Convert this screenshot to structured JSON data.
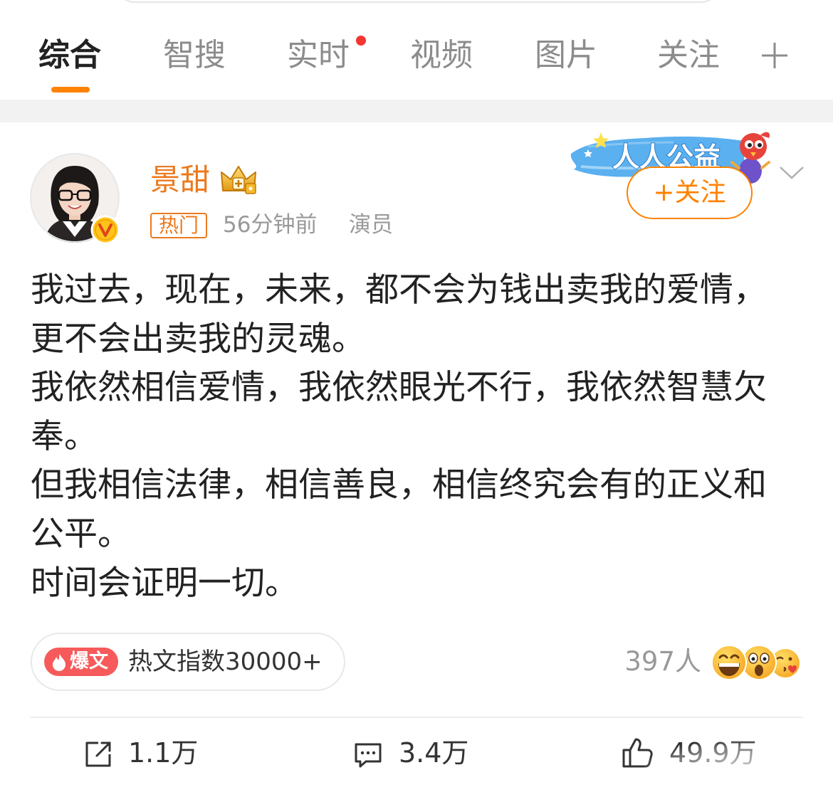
{
  "colors": {
    "accent": "#ff8200",
    "username": "#eb7a1e",
    "hot": "#f65a5a",
    "dot": "#f43530",
    "text": "#222222",
    "muted": "#999999"
  },
  "tabs": {
    "items": [
      {
        "label": "综合",
        "active": true
      },
      {
        "label": "智搜",
        "active": false
      },
      {
        "label": "实时",
        "active": false,
        "dot": true
      },
      {
        "label": "视频",
        "active": false
      },
      {
        "label": "图片",
        "active": false
      },
      {
        "label": "关注",
        "active": false
      }
    ],
    "add_icon": "plus-icon"
  },
  "post": {
    "author": {
      "name": "景甜",
      "avatar": "avatar-photo",
      "verified_icon": "verified-v-badge-icon",
      "member_icon": "crown-icon"
    },
    "tag": "热门",
    "time": "56分钟前",
    "source": "演员",
    "banner": {
      "text": "人人公益",
      "mascot_icon": "weibo-mascot-icon"
    },
    "follow_label": "+关注",
    "menu_icon": "chevron-down-icon",
    "content": [
      "我过去，现在，未来，都不会为钱出卖我的爱情，更不会出卖我的灵魂。",
      "我依然相信爱情，我依然眼光不行，我依然智慧欠奉。",
      "但我相信法律，相信善良，相信终究会有的正义和公平。",
      "时间会证明一切。"
    ],
    "hot_badge": {
      "label": "爆文",
      "text": "热文指数30000+",
      "icon": "flame-icon"
    },
    "reactions": {
      "count_label": "397人",
      "emojis": [
        "laughing-emoji",
        "shocked-emoji",
        "kiss-emoji"
      ]
    },
    "actions": {
      "repost": {
        "icon": "repost-icon",
        "count": "1.1万"
      },
      "comment": {
        "icon": "comment-icon",
        "count": "3.4万"
      },
      "like": {
        "icon": "thumbs-up-icon",
        "count": "49.9万"
      }
    }
  }
}
